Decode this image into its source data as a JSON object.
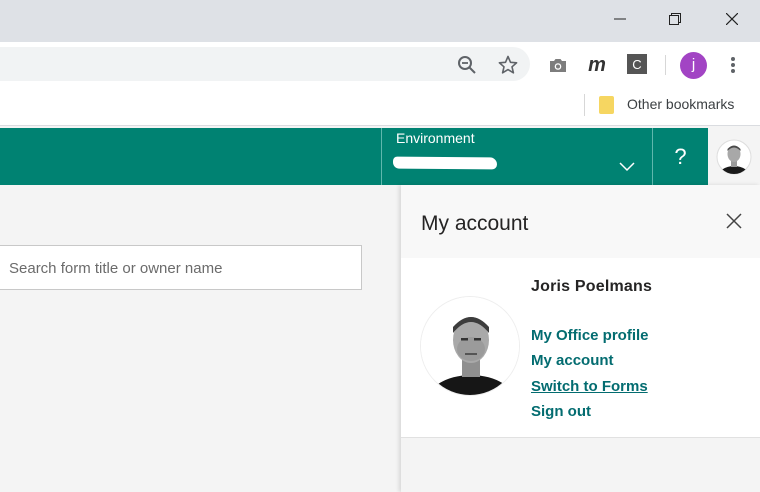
{
  "browser": {
    "window_controls": [
      "minimize-icon",
      "restore-icon",
      "close-icon"
    ],
    "toolbar_icons": [
      "zoom-out-icon",
      "star-icon",
      "camera-icon",
      "m-extension-icon",
      "c-extension-icon",
      "menu-icon"
    ],
    "profile_initial": "j",
    "extension_m_label": "m",
    "extension_c_label": "C",
    "bookmarks": {
      "other_label": "Other bookmarks"
    }
  },
  "header": {
    "environment_label": "Environment",
    "help_label": "?",
    "brand_color": "#008272"
  },
  "main": {
    "search_placeholder": "Search form title or owner name"
  },
  "account_panel": {
    "title": "My account",
    "user_name": "Joris Poelmans",
    "links": [
      "My Office profile",
      "My account",
      "Switch to Forms",
      "Sign out"
    ],
    "link_color": "#036c70"
  }
}
